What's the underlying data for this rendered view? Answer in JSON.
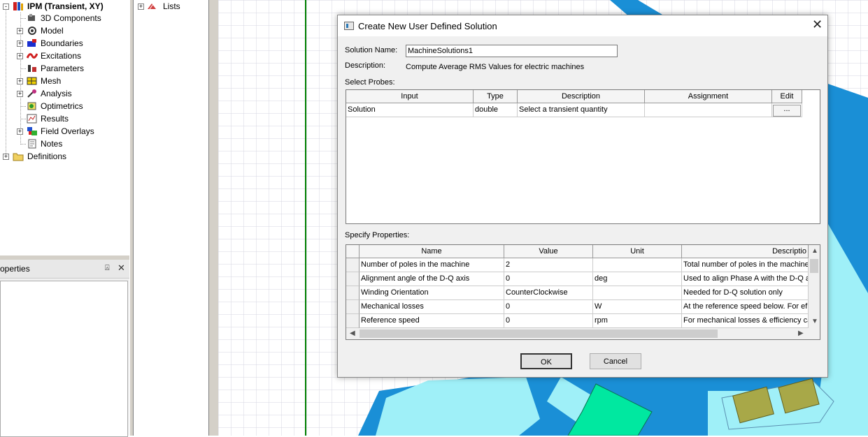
{
  "tree": {
    "root": "IPM (Transient, XY)",
    "items": [
      "3D Components",
      "Model",
      "Boundaries",
      "Excitations",
      "Parameters",
      "Mesh",
      "Analysis",
      "Optimetrics",
      "Results",
      "Field Overlays",
      "Notes"
    ],
    "definitions": "Definitions"
  },
  "lists_pane": {
    "item": "Lists"
  },
  "properties_panel": {
    "title": "operties",
    "pin": "⍓",
    "close": "✕"
  },
  "dialog": {
    "title": "Create New User Defined Solution",
    "close_glyph": "✕",
    "solution_name_label": "Solution Name:",
    "solution_name_value": "MachineSolutions1",
    "description_label": "Description:",
    "description_value": "Compute Average  RMS Values for electric machines",
    "select_probes_label": "Select Probes:",
    "probes": {
      "columns": [
        "Input",
        "Type",
        "Description",
        "Assignment",
        "Edit"
      ],
      "rows": [
        {
          "input": "Solution",
          "type": "double",
          "description": "Select a transient quantity",
          "assignment": "",
          "edit": "..."
        }
      ]
    },
    "specify_properties_label": "Specify Properties:",
    "properties": {
      "columns": [
        "Name",
        "Value",
        "Unit",
        "Descriptio"
      ],
      "rows": [
        {
          "name": "Number of poles in the machine",
          "value": "2",
          "unit": "",
          "description": "Total number of poles in the machine"
        },
        {
          "name": "Alignment angle of the D-Q axis",
          "value": "0",
          "unit": "deg",
          "description": "Used to align Phase A with the D-Q a"
        },
        {
          "name": "Winding Orientation",
          "value": "CounterClockwise",
          "unit": "",
          "description": "Needed for D-Q solution only"
        },
        {
          "name": "Mechanical losses",
          "value": "0",
          "unit": "W",
          "description": "At the reference speed below. For ef"
        },
        {
          "name": "Reference speed",
          "value": "0",
          "unit": "rpm",
          "description": "For mechanical losses & efficiency cal"
        }
      ]
    },
    "ok_label": "OK",
    "cancel_label": "Cancel"
  },
  "colors": {
    "stator_blue": "#1a8fd6",
    "airgap_cyan": "#9ff0f8",
    "magnet_green": "#00e8a0",
    "conductor_olive": "#a8a848",
    "guide_line_green": "#008000"
  }
}
